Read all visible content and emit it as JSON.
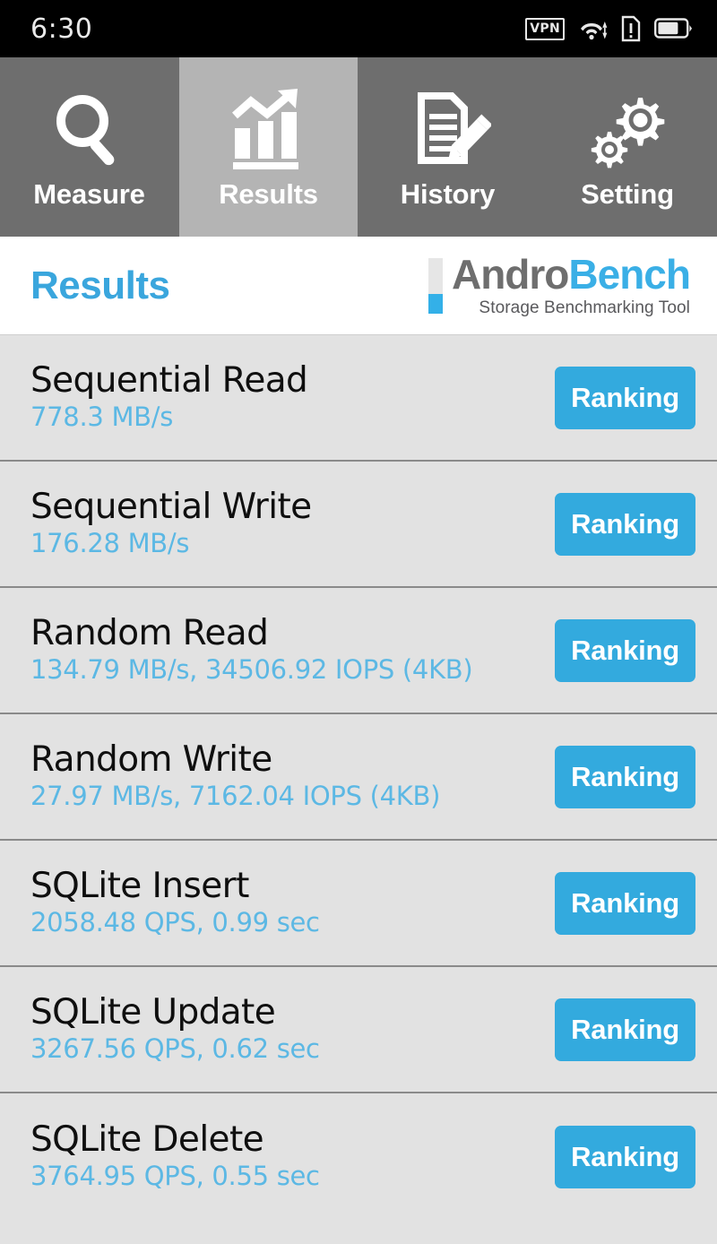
{
  "status_bar": {
    "time": "6:30",
    "icons": [
      {
        "name": "vpn-icon",
        "label": "VPN"
      },
      {
        "name": "wifi-icon",
        "label": ""
      },
      {
        "name": "sim-alert-icon",
        "label": "!"
      },
      {
        "name": "battery-icon",
        "label": ""
      }
    ]
  },
  "tabs": [
    {
      "id": "measure",
      "label": "Measure",
      "icon": "magnifier-icon",
      "active": false
    },
    {
      "id": "results",
      "label": "Results",
      "icon": "bar-chart-trend-icon",
      "active": true
    },
    {
      "id": "history",
      "label": "History",
      "icon": "document-pencil-icon",
      "active": false
    },
    {
      "id": "setting",
      "label": "Setting",
      "icon": "gears-icon",
      "active": false
    }
  ],
  "header": {
    "page_title": "Results",
    "logo_primary": "Andro",
    "logo_secondary": "Bench",
    "logo_tagline": "Storage Benchmarking Tool"
  },
  "results": [
    {
      "title": "Sequential Read",
      "value": "778.3 MB/s",
      "button": "Ranking"
    },
    {
      "title": "Sequential Write",
      "value": "176.28 MB/s",
      "button": "Ranking"
    },
    {
      "title": "Random Read",
      "value": "134.79 MB/s, 34506.92 IOPS (4KB)",
      "button": "Ranking"
    },
    {
      "title": "Random Write",
      "value": "27.97 MB/s, 7162.04 IOPS (4KB)",
      "button": "Ranking"
    },
    {
      "title": "SQLite Insert",
      "value": "2058.48 QPS, 0.99 sec",
      "button": "Ranking"
    },
    {
      "title": "SQLite Update",
      "value": "3267.56 QPS, 0.62 sec",
      "button": "Ranking"
    },
    {
      "title": "SQLite Delete",
      "value": "3764.95 QPS, 0.55 sec",
      "button": "Ranking"
    }
  ],
  "colors": {
    "accent_blue": "#33aade",
    "value_blue": "#5cb8e4",
    "title_blue": "#3aa6dd",
    "tab_inactive": "#6e6e6e",
    "tab_active": "#b4b4b4",
    "row_bg": "#e2e2e2",
    "status_bg": "#000000"
  }
}
